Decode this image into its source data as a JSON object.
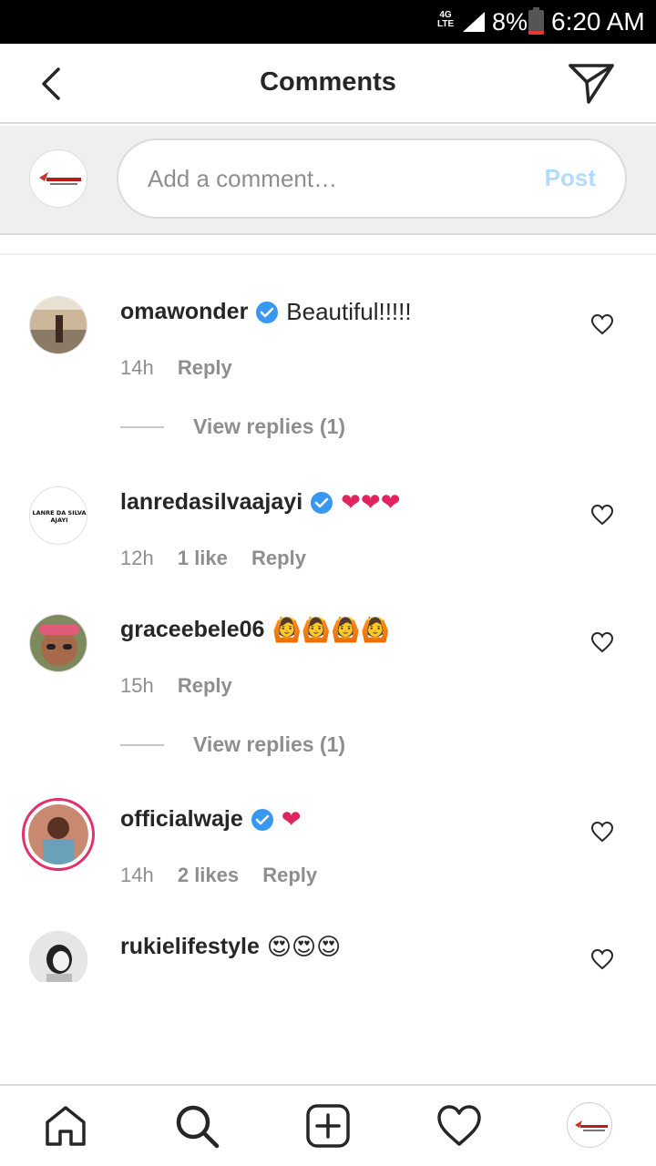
{
  "status_bar": {
    "network": "4G LTE",
    "battery": "8%",
    "time": "6:20 AM"
  },
  "header": {
    "title": "Comments"
  },
  "composer": {
    "placeholder": "Add a comment…",
    "post_label": "Post"
  },
  "comments": [
    {
      "username": "omawonder",
      "verified": true,
      "text": "Beautiful!!!!!",
      "time": "14h",
      "likes": "",
      "reply": "Reply",
      "view_replies": "View replies (1)"
    },
    {
      "username": "lanredasilvaajayi",
      "verified": true,
      "text": "❤❤❤",
      "time": "12h",
      "likes": "1 like",
      "reply": "Reply",
      "view_replies": "",
      "avatar_text": "LANRE DA SILVA AJAYI"
    },
    {
      "username": "graceebele06",
      "verified": false,
      "text": "🙆🙆🙆🙆",
      "time": "15h",
      "likes": "",
      "reply": "Reply",
      "view_replies": "View replies (1)"
    },
    {
      "username": "officialwaje",
      "verified": true,
      "text": "❤",
      "time": "14h",
      "likes": "2 likes",
      "reply": "Reply",
      "view_replies": ""
    },
    {
      "username": "rukielifestyle",
      "verified": false,
      "text": "😍😍😍",
      "time": "",
      "likes": "",
      "reply": "",
      "view_replies": ""
    }
  ],
  "bottom_nav": {
    "items": [
      "home-icon",
      "search-icon",
      "add-post-icon",
      "activity-heart-icon",
      "profile-avatar"
    ]
  },
  "colors": {
    "verified_blue": "#3897f0",
    "post_disabled": "#b3dbff",
    "meta_gray": "#8e8e8e",
    "heart_red": "#ed4956"
  }
}
